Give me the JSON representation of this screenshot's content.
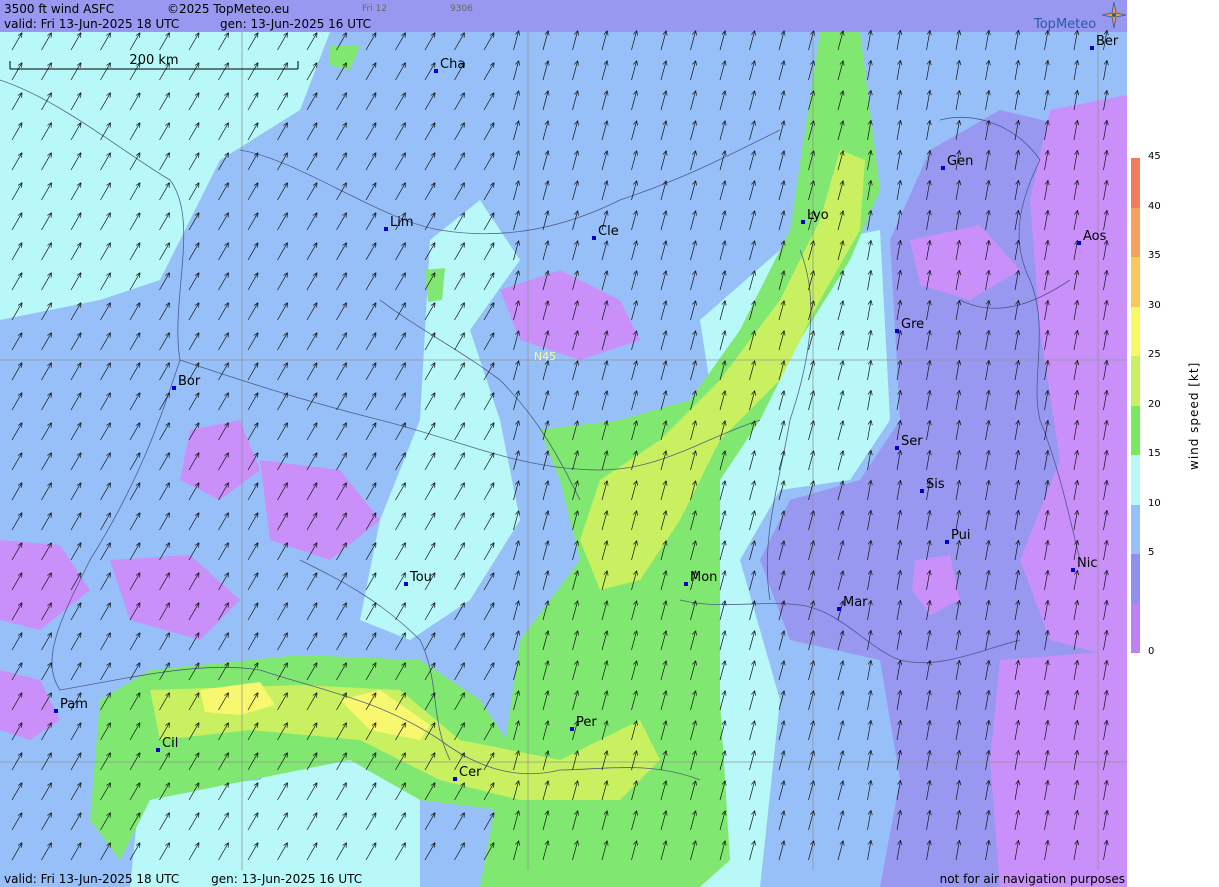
{
  "header": {
    "title": "3500 ft wind ASFC",
    "copyright": "©2025 TopMeteo.eu",
    "frame": "Fri 12",
    "code": "9306",
    "valid": "valid:  Fri  13-Jun-2025  18 UTC",
    "gen": "gen: 13-Jun-2025 16 UTC"
  },
  "footer": {
    "valid": "valid:  Fri  13-Jun-2025  18 UTC",
    "gen": "gen: 13-Jun-2025 16 UTC",
    "disclaimer": "not for air navigation purposes"
  },
  "logo": {
    "text": "TopMeteo",
    "icon": "compass-star-icon"
  },
  "scale_bar": {
    "label": "200 km"
  },
  "grid_label": "N45",
  "cities": [
    {
      "name": "Cha"
    },
    {
      "name": "Ber"
    },
    {
      "name": "Gen"
    },
    {
      "name": "Lim"
    },
    {
      "name": "Cle"
    },
    {
      "name": "Lyo"
    },
    {
      "name": "Aos"
    },
    {
      "name": "Gre"
    },
    {
      "name": "Bor"
    },
    {
      "name": "Ser"
    },
    {
      "name": "Sis"
    },
    {
      "name": "Pui"
    },
    {
      "name": "Tou"
    },
    {
      "name": "Mon"
    },
    {
      "name": "Mar"
    },
    {
      "name": "Nic"
    },
    {
      "name": "Pam"
    },
    {
      "name": "Per"
    },
    {
      "name": "Cil"
    },
    {
      "name": "Cer"
    }
  ],
  "legend": {
    "title": "wind  speed  [kt]",
    "ticks": [
      "45",
      "40",
      "35",
      "30",
      "25",
      "20",
      "15",
      "10",
      "5",
      "0"
    ],
    "colors": [
      "#f47a60",
      "#f5a05c",
      "#f8c85c",
      "#f8f860",
      "#c8f060",
      "#78e860",
      "#b8f8f8",
      "#98c0f8",
      "#9090f0",
      "#c080f8"
    ]
  },
  "colors": {
    "calm": "#c890f8",
    "light": "#9898f0",
    "moderate": "#98c0f8",
    "fresh": "#b8f8f8",
    "strong": "#80e870",
    "stronger": "#c8f060",
    "gusty": "#f8f870"
  }
}
